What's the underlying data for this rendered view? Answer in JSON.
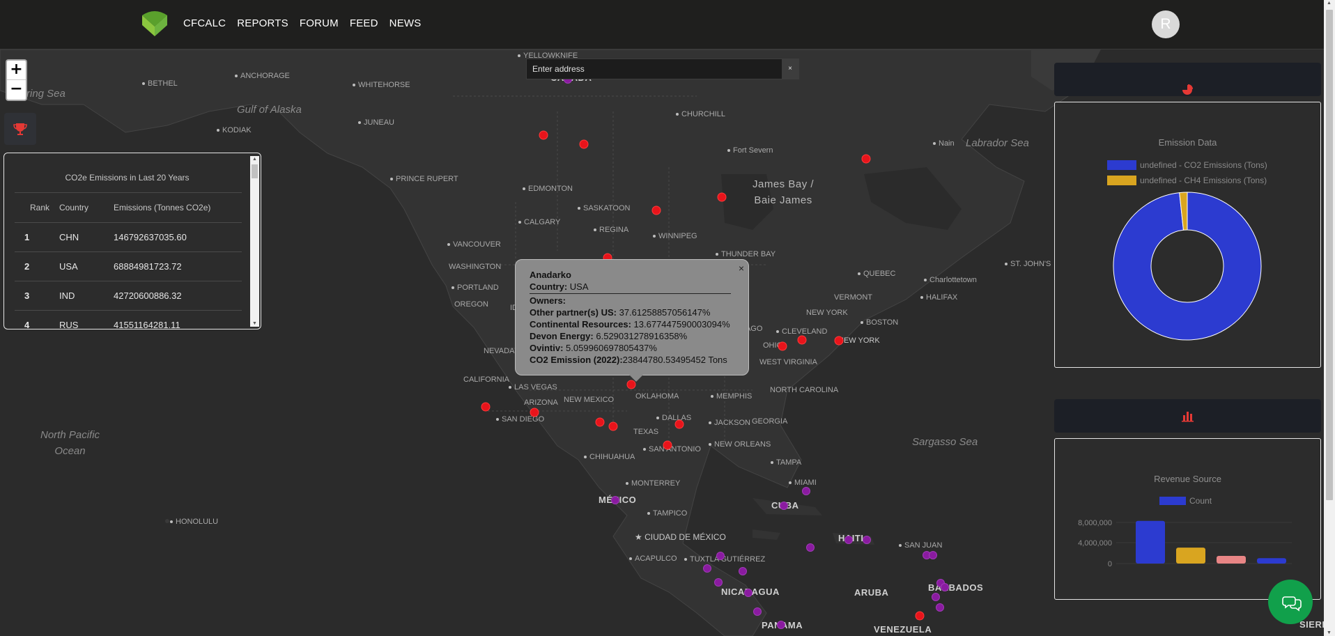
{
  "header": {
    "nav": [
      "CFCALC",
      "REPORTS",
      "FORUM",
      "FEED",
      "NEWS"
    ],
    "avatar_initial": "R"
  },
  "map": {
    "zoom_in": "+",
    "zoom_out": "−",
    "labels": {
      "bering_sea": "ring Sea",
      "gulf_of_alaska": "Gulf of Alaska",
      "north_pacific": "North Pacific\nOcean",
      "labrador_sea": "Labrador Sea",
      "james_bay": "James Bay /\nBaie James",
      "sargasso_sea": "Sargasso Sea",
      "bethel": "BETHEL",
      "anchorage": "ANCHORAGE",
      "kodiak": "KODIAK",
      "yellowknife": "YELLOWKNIFE",
      "canada": "CANADA",
      "whitehorse": "WHITEHORSE",
      "juneau": "JUNEAU",
      "churchill": "CHURCHILL",
      "fort_severn": "Fort Severn",
      "nain": "Nain",
      "prince_rupert": "PRINCE RUPERT",
      "edmonton": "EDMONTON",
      "saskatoon": "SASKATOON",
      "calgary": "CALGARY",
      "regina": "REGINA",
      "winnipeg": "WINNIPEG",
      "vancouver": "VANCOUVER",
      "thunder_bay": "THUNDER BAY",
      "washington": "WASHINGTON",
      "portland": "PORTLAND",
      "oregon": "OREGON",
      "quebec": "QUEBEC",
      "charlottetown": "Charlottetown",
      "st_johns": "ST. JOHN'S",
      "halifax": "HALIFAX",
      "vermont": "VERMONT",
      "new_york_state": "NEW YORK",
      "boston": "BOSTON",
      "new_york": "NEW YORK",
      "cleveland": "CLEVELAND",
      "ohio": "OHIO",
      "west_virginia": "WEST VIRGINIA",
      "cago": "CAGO",
      "nevada": "NEVADA",
      "california": "CALIFORNIA",
      "las_vegas": "LAS VEGAS",
      "arizona": "ARIZONA",
      "new_mexico": "NEW MEXICO",
      "oklahoma": "OKLAHOMA",
      "memphis": "MEMPHIS",
      "north_carolina": "NORTH CAROLINA",
      "san_diego": "SAN DIEGO",
      "dallas": "DALLAS",
      "jackson": "JACKSON",
      "georgia": "GEORGIA",
      "texas": "TEXAS",
      "san_antonio": "SAN ANTONIO",
      "new_orleans": "NEW ORLEANS",
      "chihuahua": "CHIHUAHUA",
      "tampa": "TAMPA",
      "miami": "MIAMI",
      "monterrey": "MONTERREY",
      "mexico": "MÉXICO",
      "tampico": "TAMPICO",
      "cuba": "CUBA",
      "honolulu": "HONOLULU",
      "ciudad_de_mexico": "CIUDAD DE MÉXICO",
      "haiti": "HAITI",
      "san_juan": "SAN JUAN",
      "acapulco": "ACAPULCO",
      "tuxtla": "TUXTLA GUTIÉRREZ",
      "nicaragua": "NICARAGUA",
      "aruba": "ARUBA",
      "barbados": "BARBADOS",
      "panama": "PANAMA",
      "venezuela": "VENEZUELA",
      "sierra": "SIERR",
      "id": "ID"
    }
  },
  "search": {
    "placeholder": "Enter address",
    "clear": "×"
  },
  "ranking": {
    "title": "CO2e Emissions in Last 20 Years",
    "headers": [
      "Rank",
      "Country",
      "Emissions (Tonnes CO2e)"
    ],
    "rows": [
      {
        "rank": "1",
        "country": "CHN",
        "emissions": "146792637035.60"
      },
      {
        "rank": "2",
        "country": "USA",
        "emissions": "68884981723.72"
      },
      {
        "rank": "3",
        "country": "IND",
        "emissions": "42720600886.32"
      },
      {
        "rank": "4",
        "country": "RUS",
        "emissions": "41551164281.11"
      }
    ]
  },
  "popup": {
    "close": "×",
    "name": "Anadarko",
    "country_label": "Country:",
    "country": "USA",
    "owners_label": "Owners:",
    "owners": [
      {
        "label": "Other partner(s) US:",
        "value": "37.61258857056147%"
      },
      {
        "label": "Continental Resources:",
        "value": "13.677447590003094%"
      },
      {
        "label": "Devon Energy:",
        "value": "6.529031278916358%"
      },
      {
        "label": "Ovintiv:",
        "value": "5.059960697805437%"
      }
    ],
    "emission_label": "CO2 Emission (2022):",
    "emission_value": "23844780.53495452 Tons"
  },
  "emission_chart": {
    "title": "Emission Data",
    "legend": [
      {
        "label": "undefined - CO2 Emissions (Tons)",
        "color": "#2c3bd0"
      },
      {
        "label": "undefined - CH4 Emissions (Tons)",
        "color": "#d9a520"
      }
    ]
  },
  "revenue_chart": {
    "title": "Revenue Source",
    "legend_label": "Count",
    "y_ticks": [
      "8,000,000",
      "4,000,000",
      "0"
    ]
  },
  "chart_data": [
    {
      "type": "pie",
      "title": "Emission Data",
      "labels": [
        "undefined - CO2 Emissions (Tons)",
        "undefined - CH4 Emissions (Tons)"
      ],
      "values": [
        98.3,
        1.7
      ],
      "colors": [
        "#2c3bd0",
        "#d9a520"
      ],
      "donut": true
    },
    {
      "type": "bar",
      "title": "Revenue Source",
      "legend": [
        "Count"
      ],
      "values": [
        8300000,
        3100000,
        1500000,
        1050000
      ],
      "colors": [
        "#2c3bd0",
        "#d9a520",
        "#e88585",
        "#2c3bd0"
      ],
      "ylim": [
        0,
        9000000
      ]
    }
  ]
}
